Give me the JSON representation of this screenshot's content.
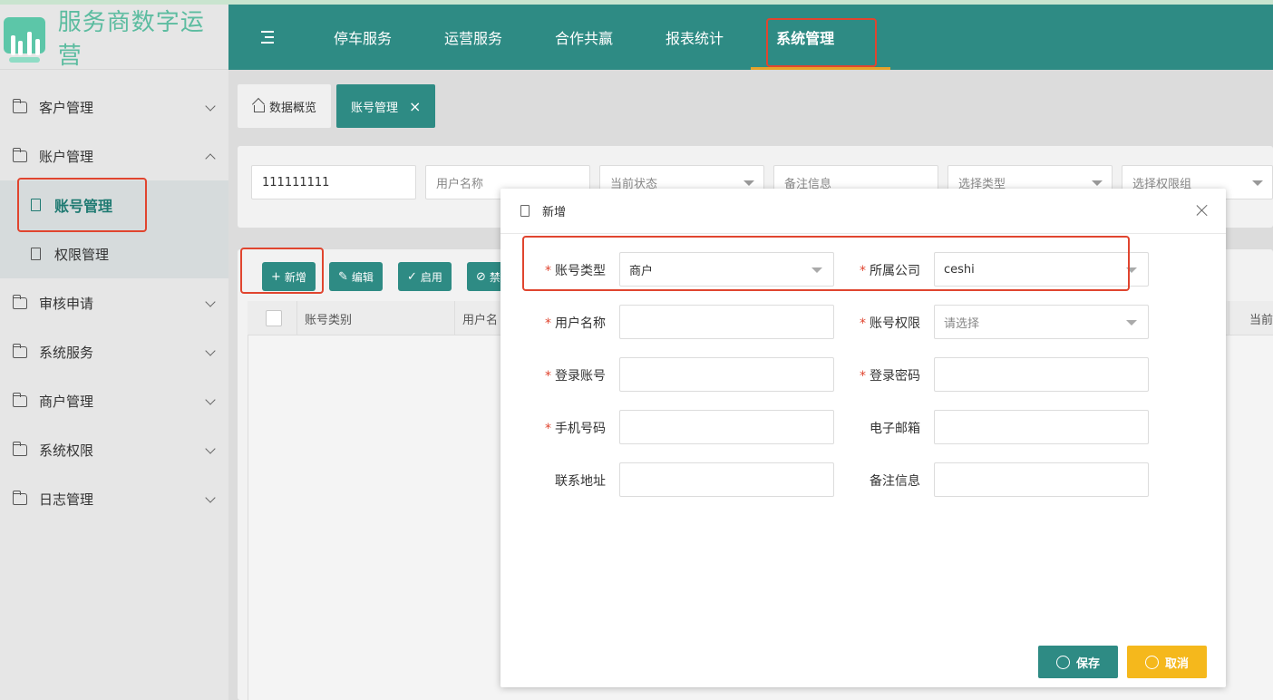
{
  "app": {
    "title": "服务商数字运营"
  },
  "topnav": {
    "items": [
      "停车服务",
      "运营服务",
      "合作共赢",
      "报表统计",
      "系统管理"
    ],
    "active_index": 4
  },
  "sidebar": {
    "items": [
      {
        "label": "客户管理",
        "expanded": false
      },
      {
        "label": "账户管理",
        "expanded": true,
        "children": [
          {
            "label": "账号管理",
            "active": true
          },
          {
            "label": "权限管理",
            "active": false
          }
        ]
      },
      {
        "label": "审核申请",
        "expanded": false
      },
      {
        "label": "系统服务",
        "expanded": false
      },
      {
        "label": "商户管理",
        "expanded": false
      },
      {
        "label": "系统权限",
        "expanded": false
      },
      {
        "label": "日志管理",
        "expanded": false
      }
    ]
  },
  "tabs": [
    {
      "label": "数据概览",
      "active": false
    },
    {
      "label": "账号管理",
      "active": true,
      "close": "×"
    }
  ],
  "filters": {
    "account_value": "111111111",
    "username_placeholder": "用户名称",
    "status_placeholder": "当前状态",
    "remark_placeholder": "备注信息",
    "type_placeholder": "选择类型",
    "group_placeholder": "选择权限组"
  },
  "toolbar": {
    "add": "新增",
    "edit": "编辑",
    "enable": "启用",
    "disable_partial": "禁"
  },
  "table": {
    "headers": [
      "账号类别",
      "用户名",
      "当前"
    ]
  },
  "modal": {
    "title": "新增",
    "fields": {
      "account_type": {
        "label": "账号类型",
        "value": "商户",
        "required": "*"
      },
      "company": {
        "label": "所属公司",
        "value": "ceshi",
        "required": "*"
      },
      "username": {
        "label": "用户名称",
        "value": "",
        "required": "*"
      },
      "permission": {
        "label": "账号权限",
        "value": "请选择",
        "required": "*"
      },
      "login_account": {
        "label": "登录账号",
        "value": "",
        "required": "*"
      },
      "login_password": {
        "label": "登录密码",
        "value": "",
        "required": "*"
      },
      "phone": {
        "label": "手机号码",
        "value": "",
        "required": "*"
      },
      "email": {
        "label": "电子邮箱",
        "value": ""
      },
      "address": {
        "label": "联系地址",
        "value": ""
      },
      "remark": {
        "label": "备注信息",
        "value": ""
      }
    },
    "save": "保存",
    "cancel": "取消"
  },
  "colors": {
    "primary": "#2e8b84",
    "accent": "#e5a32a",
    "cancel": "#f5b81c",
    "annotation": "#e0452f"
  }
}
